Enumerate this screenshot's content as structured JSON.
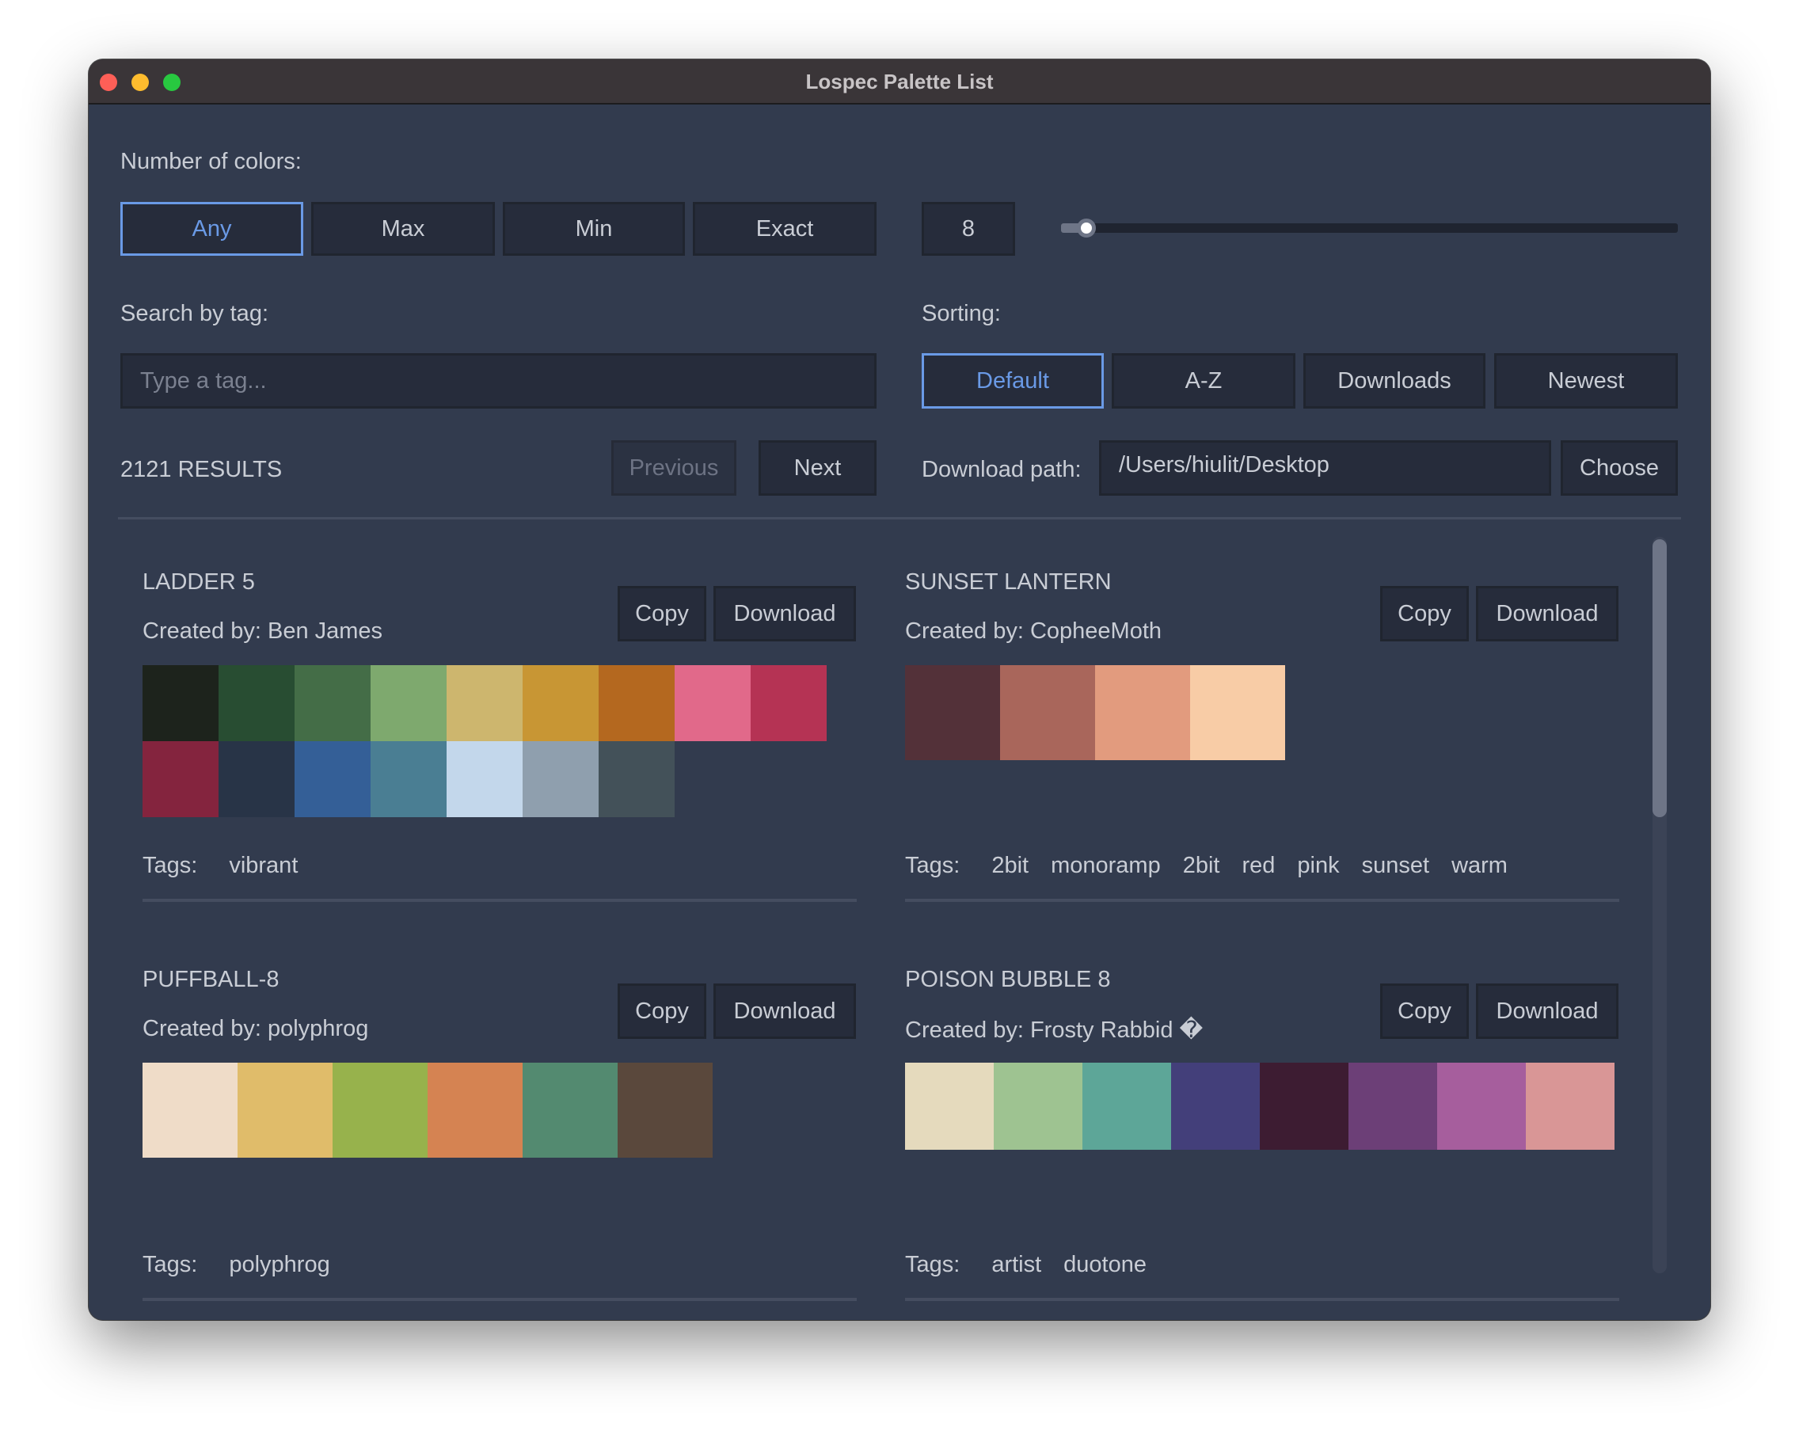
{
  "window": {
    "title": "Lospec Palette List"
  },
  "colors_filter": {
    "label": "Number of colors:",
    "modes": [
      "Any",
      "Max",
      "Min",
      "Exact"
    ],
    "selected": "Any",
    "count": "8",
    "slider_value": 8
  },
  "search": {
    "label": "Search by tag:",
    "placeholder": "Type a tag...",
    "value": ""
  },
  "sorting": {
    "label": "Sorting:",
    "options": [
      "Default",
      "A-Z",
      "Downloads",
      "Newest"
    ],
    "selected": "Default"
  },
  "results": {
    "count_text": "2121 RESULTS",
    "previous": "Previous",
    "next": "Next"
  },
  "download": {
    "label": "Download path:",
    "path": "/Users/hiulit/Desktop",
    "choose": "Choose"
  },
  "card_labels": {
    "copy": "Copy",
    "download": "Download",
    "tags": "Tags:"
  },
  "palettes": [
    {
      "name": "LADDER 5",
      "creator": "Created by: Ben James",
      "colors": [
        "#1d231c",
        "#284d32",
        "#446d47",
        "#7ea96e",
        "#cdb66e",
        "#c89634",
        "#b4681f",
        "#e1698a",
        "#b53354",
        "#84243e",
        "#283447",
        "#345f97",
        "#4a7e93",
        "#c3d7eb",
        "#8f9fae",
        "#435159"
      ],
      "tags": [
        "vibrant"
      ]
    },
    {
      "name": "SUNSET LANTERN",
      "creator": "Created by: CopheeMoth",
      "colors": [
        "#533139",
        "#a9665b",
        "#e29b7e",
        "#f8cca6"
      ],
      "tags": [
        "2bit",
        "monoramp",
        "2bit",
        "red",
        "pink",
        "sunset",
        "warm"
      ]
    },
    {
      "name": "PUFFBALL-8",
      "creator": "Created by: polyphrog",
      "colors": [
        "#efdcc8",
        "#e0bc6a",
        "#97b24c",
        "#d58352",
        "#538a70",
        "#5a483c"
      ],
      "tags": [
        "polyphrog"
      ]
    },
    {
      "name": "POISON BUBBLE 8",
      "creator": "Created by: Frosty Rabbid �",
      "colors": [
        "#e5dabd",
        "#9ec391",
        "#5da698",
        "#433f7a",
        "#3d1c32",
        "#6c3f77",
        "#a65e9d",
        "#d99696"
      ],
      "tags": [
        "artist",
        "duotone"
      ]
    }
  ]
}
